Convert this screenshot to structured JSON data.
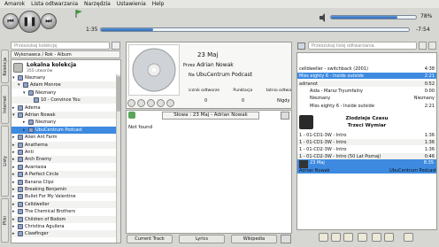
{
  "menu": [
    "Amarok",
    "Lista odtwarzania",
    "Narzędzia",
    "Ustawienia",
    "Help"
  ],
  "transport": {
    "elapsed": "1:35",
    "remaining": "-7:54",
    "volume": "78%",
    "progress": 0.17,
    "volume_level": 0.78
  },
  "sidebar_tabs": [
    "Kolekcja",
    "Internet",
    "Listy",
    "Pliki"
  ],
  "collection": {
    "search_placeholder": "Przeszukaj kolekcję",
    "filter": "Wykonawca / Rok - Album",
    "title": "Lokalna kolekcja",
    "subtitle": "355 utworów",
    "rows": [
      {
        "label": "Nieznany",
        "level": 0,
        "arrow": "▾"
      },
      {
        "label": "Adam Monroe",
        "level": 1,
        "arrow": "▾"
      },
      {
        "label": "Nieznany",
        "level": 2,
        "arrow": "▾"
      },
      {
        "label": "10 - Convince You",
        "level": 3,
        "arrow": ""
      },
      {
        "label": "Adema",
        "level": 0,
        "arrow": "▸"
      },
      {
        "label": "Adrian Nowak",
        "level": 0,
        "arrow": "▾"
      },
      {
        "label": "Nieznany",
        "level": 2,
        "arrow": "▸"
      },
      {
        "label": "UbuCentrum Podcast",
        "level": 2,
        "arrow": "▸"
      },
      {
        "label": "Alien Ant Farm",
        "level": 0,
        "arrow": "▸"
      },
      {
        "label": "Anathema",
        "level": 0,
        "arrow": "▸"
      },
      {
        "label": "Anti",
        "level": 0,
        "arrow": "▸"
      },
      {
        "label": "Arch Enemy",
        "level": 0,
        "arrow": "▸"
      },
      {
        "label": "Avantasia",
        "level": 0,
        "arrow": "▸"
      },
      {
        "label": "A Perfect Circle",
        "level": 0,
        "arrow": "▸"
      },
      {
        "label": "Banana Clipz",
        "level": 0,
        "arrow": "▸"
      },
      {
        "label": "Breaking Benjamin",
        "level": 0,
        "arrow": "▸"
      },
      {
        "label": "Bullet For My Valentine",
        "level": 0,
        "arrow": "▸"
      },
      {
        "label": "Celldweller",
        "level": 0,
        "arrow": "▸"
      },
      {
        "label": "The Chemical Brothers",
        "level": 0,
        "arrow": "▸"
      },
      {
        "label": "Children of Bodom",
        "level": 0,
        "arrow": "▸"
      },
      {
        "label": "Christina Aguilera",
        "level": 0,
        "arrow": "▸"
      },
      {
        "label": "Clawfinger",
        "level": 0,
        "arrow": "▸"
      }
    ],
    "selected_index": 7
  },
  "nowplaying": {
    "title": "23 Maj",
    "artist_prefix": "Przez",
    "artist": "Adrian Nowak",
    "album_prefix": "Na",
    "album": "UbuCentrum Podcast",
    "stats_headers": [
      "icznik odtworze",
      "Punktacja",
      "tatnio odtwa"
    ],
    "stats_values": [
      "0",
      "0",
      "Nigdy"
    ]
  },
  "lyrics": {
    "header": "Słowa : 23 Maj - Adrian Nowak",
    "body": "Not found"
  },
  "bottom_tabs": [
    "Current Track",
    "Lyrics",
    "Wikipedia"
  ],
  "playlist": {
    "search_placeholder": "Przeszukaj listę odtwarzania",
    "rows": [
      {
        "left": "celldweller - switchback (2001)",
        "right": "4:38",
        "style": ""
      },
      {
        "left": "Miss eighty 6 - Inside outside",
        "right": "2:21",
        "style": "sel"
      },
      {
        "left": "adrianot",
        "right": "0:52",
        "style": "alt"
      },
      {
        "left": "Aida - Marsz Tryumfalny",
        "right": "0:00",
        "style": "icon"
      },
      {
        "left": "Nieznany",
        "right": "Nieznany",
        "style": "icon2"
      },
      {
        "left": "Miss eighty 6 - Inside outside",
        "right": "2:21",
        "style": "icon"
      }
    ],
    "album_header": "Zlodzieje Czasu",
    "album_sub": "Trzeci Wymiar",
    "album_rows": [
      {
        "left": "1 - 01-CD1-3W - Intro",
        "right": "1:36",
        "style": ""
      },
      {
        "left": "1 - 01-CD1-3W - Intro",
        "right": "1:36",
        "style": "alt"
      },
      {
        "left": "1 - 01-CD2-3W - Intro",
        "right": "1:36",
        "style": ""
      },
      {
        "left": "1 - 01-CD2-3W - Intro (50 Lat Poznaj)",
        "right": "0:46",
        "style": "alt"
      }
    ],
    "current": {
      "title": "23 Maj",
      "time": "8:35",
      "artist": "Adrian Nowak",
      "album": "UbuCentrum Podcast"
    }
  }
}
